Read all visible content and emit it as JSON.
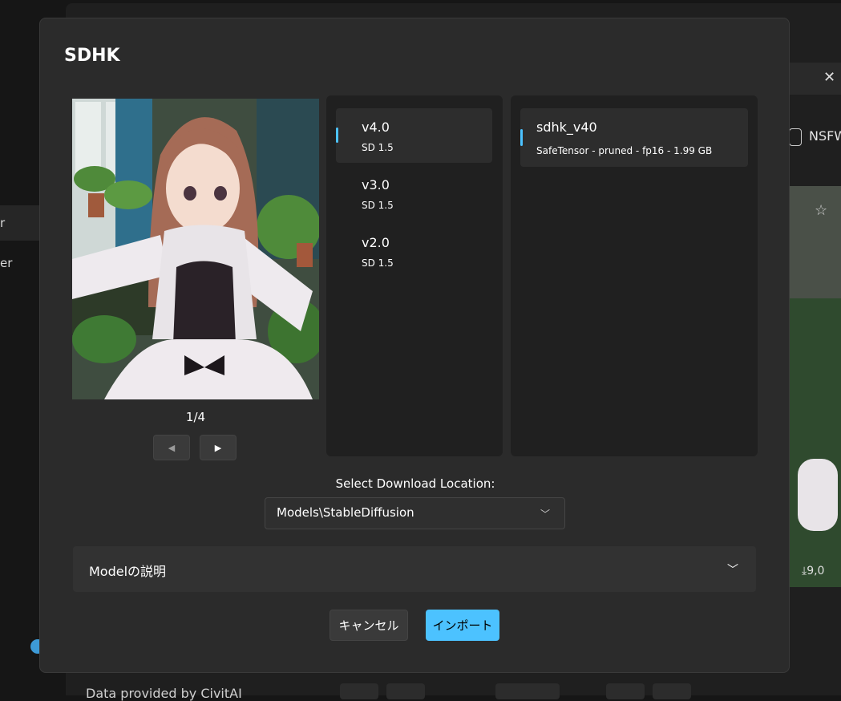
{
  "background": {
    "sidebar_items": [
      "r",
      "er"
    ],
    "nsfw_label": "NSFW",
    "download_count": "9,0",
    "footer_text": "Data provided by CivitAI"
  },
  "modal": {
    "title": "SDHK",
    "image_counter": "1/4",
    "versions": [
      {
        "name": "v4.0",
        "base": "SD 1.5",
        "selected": true
      },
      {
        "name": "v3.0",
        "base": "SD 1.5",
        "selected": false
      },
      {
        "name": "v2.0",
        "base": "SD 1.5",
        "selected": false
      }
    ],
    "files": [
      {
        "name": "sdhk_v40",
        "meta": "SafeTensor - pruned - fp16 - 1.99 GB",
        "selected": true
      }
    ],
    "download_location": {
      "label": "Select Download Location:",
      "value": "Models\\StableDiffusion"
    },
    "description_expander": "Modelの説明",
    "cancel_label": "キャンセル",
    "import_label": "インポート"
  },
  "colors": {
    "accent": "#4cc2ff",
    "modal_bg": "#2b2b2b",
    "panel_bg": "#202020"
  },
  "icons": {
    "prev": "prev-triangle-icon",
    "next": "next-triangle-icon",
    "dropdown": "chevron-down-icon"
  }
}
